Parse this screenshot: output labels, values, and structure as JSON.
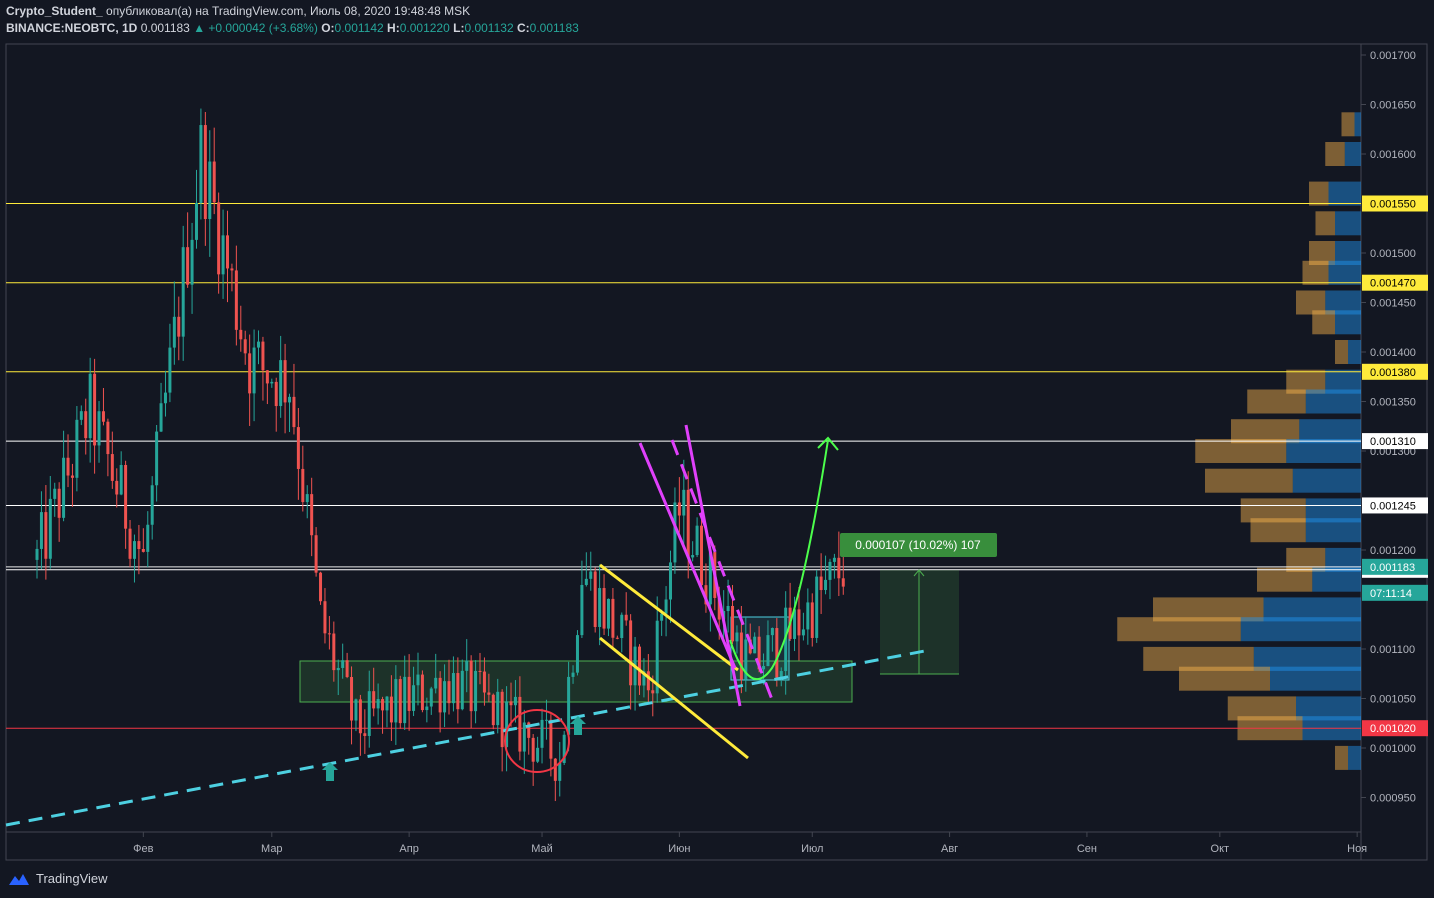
{
  "header": {
    "author": "Crypto_Student_",
    "published": "опубликовал(а) на TradingView.com, Июль 08, 2020 19:48:48 MSK",
    "symbol": "BINANCE:NEOBTC, 1D",
    "last": "0.001183",
    "change": "▲ +0.000042 (+3.68%)",
    "o_label": "O:",
    "o": "0.001142",
    "h_label": "H:",
    "h": "0.001220",
    "l_label": "L:",
    "l": "0.001132",
    "c_label": "C:",
    "c": "0.001183"
  },
  "footer": {
    "brand": "TradingView"
  },
  "colors": {
    "background": "#131722",
    "up": "#26a69a",
    "down": "#ef5350",
    "yellow": "#ffeb3b",
    "magenta": "#e040fb",
    "cyan": "#4dd0e1",
    "green_zone": "#4caf50",
    "red_line": "#f23645"
  },
  "chart_data": {
    "type": "candlestick",
    "x_ticks": [
      "Фев",
      "Мар",
      "Апр",
      "Май",
      "Июн",
      "Июл",
      "Авг",
      "Сен",
      "Окт",
      "Ноя"
    ],
    "y_ticks": [
      "0.001700",
      "0.001650",
      "0.001600",
      "0.001500",
      "0.001450",
      "0.001400",
      "0.001350",
      "0.001300",
      "0.001200",
      "0.001100",
      "0.001050",
      "0.001000",
      "0.000950"
    ],
    "ylim": [
      0.00092,
      0.00172
    ],
    "horizontal_levels": [
      {
        "value": 0.00155,
        "label": "0.001550",
        "color": "#ffeb3b",
        "style": "highlight"
      },
      {
        "value": 0.00147,
        "label": "0.001470",
        "color": "#ffeb3b",
        "style": "highlight"
      },
      {
        "value": 0.00138,
        "label": "0.001380",
        "color": "#ffeb3b",
        "style": "highlight"
      },
      {
        "value": 0.00131,
        "label": "0.001310",
        "color": "#ffffff",
        "style": "boxed"
      },
      {
        "value": 0.001245,
        "label": "0.001245",
        "color": "#ffffff",
        "style": "boxed"
      },
      {
        "value": 0.00118,
        "label": "0.001180",
        "color": "#ffffff",
        "style": "boxed"
      },
      {
        "value": 0.00102,
        "label": "0.001020",
        "color": "#f23645",
        "style": "red"
      }
    ],
    "last_price": {
      "value": 0.001183,
      "label": "0.001183",
      "countdown": "07:11:14"
    },
    "measure": {
      "label": "0.000107 (10.02%) 107",
      "from": 0.001074,
      "to": 0.001181
    },
    "key_closes": [
      {
        "date": "2020-01-08",
        "close": 0.00119
      },
      {
        "date": "2020-01-20",
        "close": 0.00134
      },
      {
        "date": "2020-02-01",
        "close": 0.00119
      },
      {
        "date": "2020-02-14",
        "close": 0.0016
      },
      {
        "date": "2020-02-25",
        "close": 0.00139
      },
      {
        "date": "2020-03-05",
        "close": 0.00137
      },
      {
        "date": "2020-03-12",
        "close": 0.00113
      },
      {
        "date": "2020-03-20",
        "close": 0.00102
      },
      {
        "date": "2020-04-10",
        "close": 0.00107
      },
      {
        "date": "2020-05-05",
        "close": 0.00099
      },
      {
        "date": "2020-05-10",
        "close": 0.00118
      },
      {
        "date": "2020-05-25",
        "close": 0.00106
      },
      {
        "date": "2020-06-01",
        "close": 0.00124
      },
      {
        "date": "2020-06-17",
        "close": 0.00108
      },
      {
        "date": "2020-06-25",
        "close": 0.00111
      },
      {
        "date": "2020-07-08",
        "close": 0.001183
      }
    ],
    "volume_profile": [
      {
        "price": 0.00163,
        "up": 0.2,
        "down": 0.1
      },
      {
        "price": 0.0016,
        "up": 0.3,
        "down": 0.25
      },
      {
        "price": 0.00156,
        "up": 0.3,
        "down": 0.5
      },
      {
        "price": 0.00153,
        "up": 0.3,
        "down": 0.4
      },
      {
        "price": 0.0015,
        "up": 0.4,
        "down": 0.4
      },
      {
        "price": 0.00148,
        "up": 0.4,
        "down": 0.5
      },
      {
        "price": 0.00145,
        "up": 0.45,
        "down": 0.55
      },
      {
        "price": 0.00143,
        "up": 0.35,
        "down": 0.4
      },
      {
        "price": 0.0014,
        "up": 0.2,
        "down": 0.2
      },
      {
        "price": 0.00137,
        "up": 0.6,
        "down": 0.55
      },
      {
        "price": 0.00135,
        "up": 0.9,
        "down": 0.85
      },
      {
        "price": 0.00132,
        "up": 1.05,
        "down": 0.95
      },
      {
        "price": 0.0013,
        "up": 1.4,
        "down": 1.15
      },
      {
        "price": 0.00127,
        "up": 1.35,
        "down": 1.05
      },
      {
        "price": 0.00124,
        "up": 1.0,
        "down": 0.85
      },
      {
        "price": 0.00122,
        "up": 0.85,
        "down": 0.85
      },
      {
        "price": 0.00119,
        "up": 0.6,
        "down": 0.55
      },
      {
        "price": 0.00117,
        "up": 0.85,
        "down": 0.75
      },
      {
        "price": 0.00114,
        "up": 1.7,
        "down": 1.5
      },
      {
        "price": 0.00112,
        "up": 1.9,
        "down": 1.85
      },
      {
        "price": 0.00109,
        "up": 1.7,
        "down": 1.65
      },
      {
        "price": 0.00107,
        "up": 1.4,
        "down": 1.4
      },
      {
        "price": 0.00104,
        "up": 1.05,
        "down": 1.0
      },
      {
        "price": 0.00102,
        "up": 1.0,
        "down": 0.9
      },
      {
        "price": 0.00099,
        "up": 0.2,
        "down": 0.2
      }
    ]
  }
}
